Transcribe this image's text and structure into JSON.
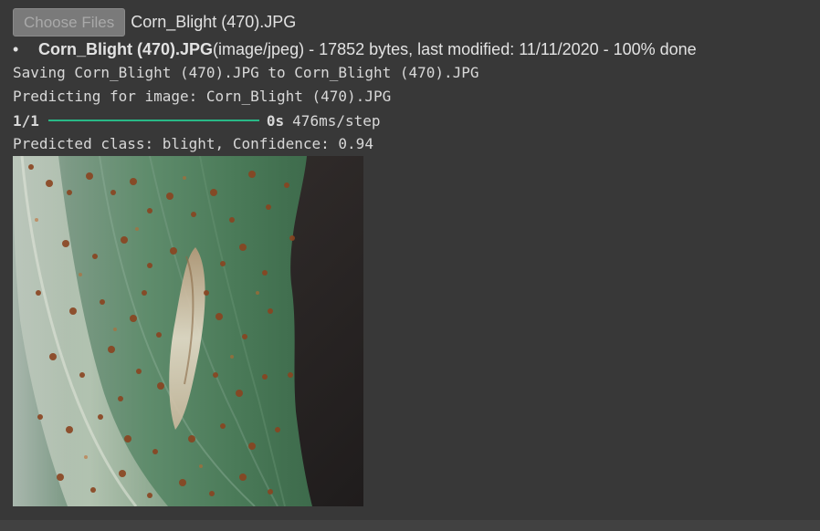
{
  "upload": {
    "button_label": "Choose Files",
    "chosen_file": "Corn_Blight (470).JPG"
  },
  "file_info": {
    "name": "Corn_Blight (470).JPG",
    "details": "(image/jpeg) - 17852 bytes, last modified: 11/11/2020 - 100% done"
  },
  "log": {
    "saving": "Saving Corn_Blight (470).JPG to Corn_Blight (470).JPG",
    "predicting": "Predicting for image: Corn_Blight (470).JPG",
    "progress_count": "1/1",
    "progress_fraction": 1.0,
    "progress_time": "0s",
    "progress_rate": "476ms/step",
    "result": "Predicted class: blight, Confidence: 0.94"
  },
  "colors": {
    "background": "#383838",
    "progress": "#29b987",
    "leaf": "#5c8a68",
    "lesion": "#8a4420"
  },
  "image": {
    "subject": "corn leaf with blight lesions"
  }
}
